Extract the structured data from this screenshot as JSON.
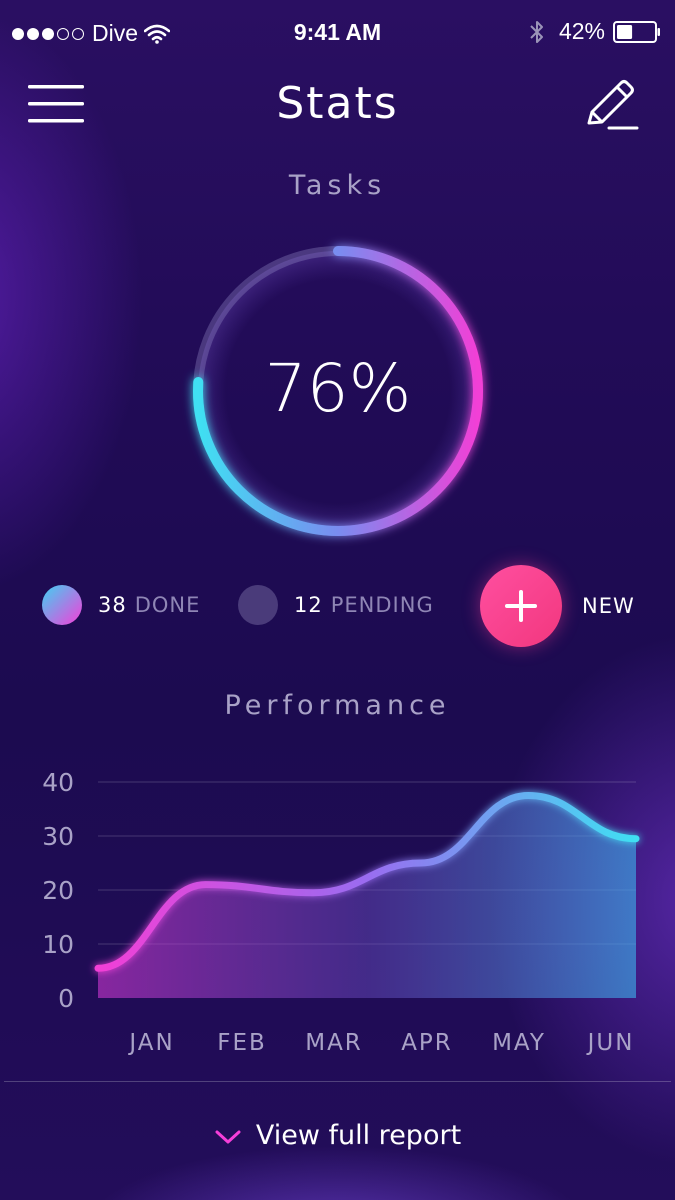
{
  "status_bar": {
    "carrier": "Dive",
    "time": "9:41 AM",
    "battery_percent": "42%",
    "signal_filled": 3,
    "signal_total": 5,
    "battery_level": 0.42
  },
  "header": {
    "title": "Stats",
    "menu_icon": "hamburger-menu-icon",
    "edit_icon": "pencil-edit-icon"
  },
  "tasks": {
    "label": "Tasks",
    "percent_label": "76%",
    "progress": 0.76,
    "done_count": "38",
    "done_label": "DONE",
    "pending_count": "12",
    "pending_label": "PENDING",
    "new_label": "NEW"
  },
  "performance": {
    "label": "Performance"
  },
  "chart_data": {
    "type": "area",
    "categories": [
      "JAN",
      "FEB",
      "MAR",
      "APR",
      "MAY",
      "JUN"
    ],
    "yticks": [
      "0",
      "10",
      "20",
      "30",
      "40"
    ],
    "ylim": [
      0,
      40
    ],
    "series": [
      {
        "values": [
          5.5,
          21,
          19.5,
          25,
          37.5,
          29.5
        ]
      }
    ],
    "grid": true
  },
  "footer": {
    "link_label": "View full report"
  },
  "colors": {
    "accent_pink": "#f53ed9",
    "accent_cyan": "#3fd2f2",
    "new_button": "#f4388a",
    "background": "#1f0b55"
  }
}
